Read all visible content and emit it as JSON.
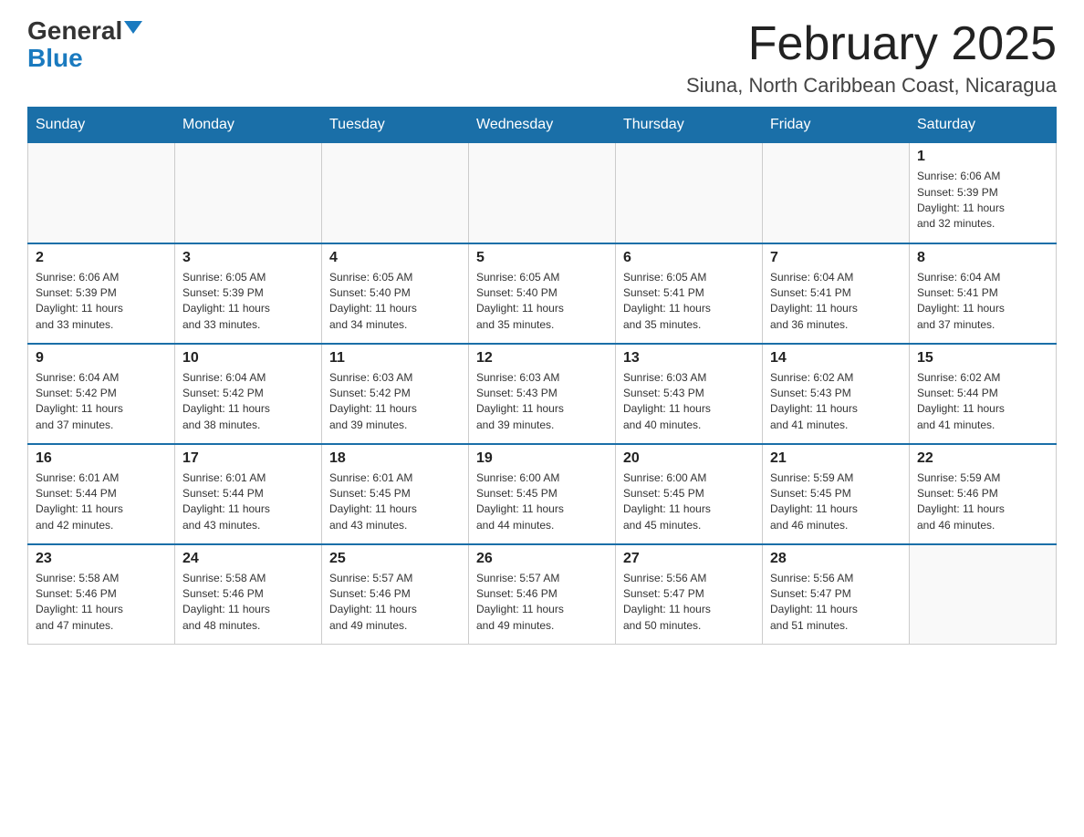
{
  "logo": {
    "text_general": "General",
    "text_blue": "Blue"
  },
  "header": {
    "month_year": "February 2025",
    "location": "Siuna, North Caribbean Coast, Nicaragua"
  },
  "weekdays": [
    "Sunday",
    "Monday",
    "Tuesday",
    "Wednesday",
    "Thursday",
    "Friday",
    "Saturday"
  ],
  "weeks": [
    [
      {
        "day": "",
        "info": ""
      },
      {
        "day": "",
        "info": ""
      },
      {
        "day": "",
        "info": ""
      },
      {
        "day": "",
        "info": ""
      },
      {
        "day": "",
        "info": ""
      },
      {
        "day": "",
        "info": ""
      },
      {
        "day": "1",
        "info": "Sunrise: 6:06 AM\nSunset: 5:39 PM\nDaylight: 11 hours\nand 32 minutes."
      }
    ],
    [
      {
        "day": "2",
        "info": "Sunrise: 6:06 AM\nSunset: 5:39 PM\nDaylight: 11 hours\nand 33 minutes."
      },
      {
        "day": "3",
        "info": "Sunrise: 6:05 AM\nSunset: 5:39 PM\nDaylight: 11 hours\nand 33 minutes."
      },
      {
        "day": "4",
        "info": "Sunrise: 6:05 AM\nSunset: 5:40 PM\nDaylight: 11 hours\nand 34 minutes."
      },
      {
        "day": "5",
        "info": "Sunrise: 6:05 AM\nSunset: 5:40 PM\nDaylight: 11 hours\nand 35 minutes."
      },
      {
        "day": "6",
        "info": "Sunrise: 6:05 AM\nSunset: 5:41 PM\nDaylight: 11 hours\nand 35 minutes."
      },
      {
        "day": "7",
        "info": "Sunrise: 6:04 AM\nSunset: 5:41 PM\nDaylight: 11 hours\nand 36 minutes."
      },
      {
        "day": "8",
        "info": "Sunrise: 6:04 AM\nSunset: 5:41 PM\nDaylight: 11 hours\nand 37 minutes."
      }
    ],
    [
      {
        "day": "9",
        "info": "Sunrise: 6:04 AM\nSunset: 5:42 PM\nDaylight: 11 hours\nand 37 minutes."
      },
      {
        "day": "10",
        "info": "Sunrise: 6:04 AM\nSunset: 5:42 PM\nDaylight: 11 hours\nand 38 minutes."
      },
      {
        "day": "11",
        "info": "Sunrise: 6:03 AM\nSunset: 5:42 PM\nDaylight: 11 hours\nand 39 minutes."
      },
      {
        "day": "12",
        "info": "Sunrise: 6:03 AM\nSunset: 5:43 PM\nDaylight: 11 hours\nand 39 minutes."
      },
      {
        "day": "13",
        "info": "Sunrise: 6:03 AM\nSunset: 5:43 PM\nDaylight: 11 hours\nand 40 minutes."
      },
      {
        "day": "14",
        "info": "Sunrise: 6:02 AM\nSunset: 5:43 PM\nDaylight: 11 hours\nand 41 minutes."
      },
      {
        "day": "15",
        "info": "Sunrise: 6:02 AM\nSunset: 5:44 PM\nDaylight: 11 hours\nand 41 minutes."
      }
    ],
    [
      {
        "day": "16",
        "info": "Sunrise: 6:01 AM\nSunset: 5:44 PM\nDaylight: 11 hours\nand 42 minutes."
      },
      {
        "day": "17",
        "info": "Sunrise: 6:01 AM\nSunset: 5:44 PM\nDaylight: 11 hours\nand 43 minutes."
      },
      {
        "day": "18",
        "info": "Sunrise: 6:01 AM\nSunset: 5:45 PM\nDaylight: 11 hours\nand 43 minutes."
      },
      {
        "day": "19",
        "info": "Sunrise: 6:00 AM\nSunset: 5:45 PM\nDaylight: 11 hours\nand 44 minutes."
      },
      {
        "day": "20",
        "info": "Sunrise: 6:00 AM\nSunset: 5:45 PM\nDaylight: 11 hours\nand 45 minutes."
      },
      {
        "day": "21",
        "info": "Sunrise: 5:59 AM\nSunset: 5:45 PM\nDaylight: 11 hours\nand 46 minutes."
      },
      {
        "day": "22",
        "info": "Sunrise: 5:59 AM\nSunset: 5:46 PM\nDaylight: 11 hours\nand 46 minutes."
      }
    ],
    [
      {
        "day": "23",
        "info": "Sunrise: 5:58 AM\nSunset: 5:46 PM\nDaylight: 11 hours\nand 47 minutes."
      },
      {
        "day": "24",
        "info": "Sunrise: 5:58 AM\nSunset: 5:46 PM\nDaylight: 11 hours\nand 48 minutes."
      },
      {
        "day": "25",
        "info": "Sunrise: 5:57 AM\nSunset: 5:46 PM\nDaylight: 11 hours\nand 49 minutes."
      },
      {
        "day": "26",
        "info": "Sunrise: 5:57 AM\nSunset: 5:46 PM\nDaylight: 11 hours\nand 49 minutes."
      },
      {
        "day": "27",
        "info": "Sunrise: 5:56 AM\nSunset: 5:47 PM\nDaylight: 11 hours\nand 50 minutes."
      },
      {
        "day": "28",
        "info": "Sunrise: 5:56 AM\nSunset: 5:47 PM\nDaylight: 11 hours\nand 51 minutes."
      },
      {
        "day": "",
        "info": ""
      }
    ]
  ]
}
